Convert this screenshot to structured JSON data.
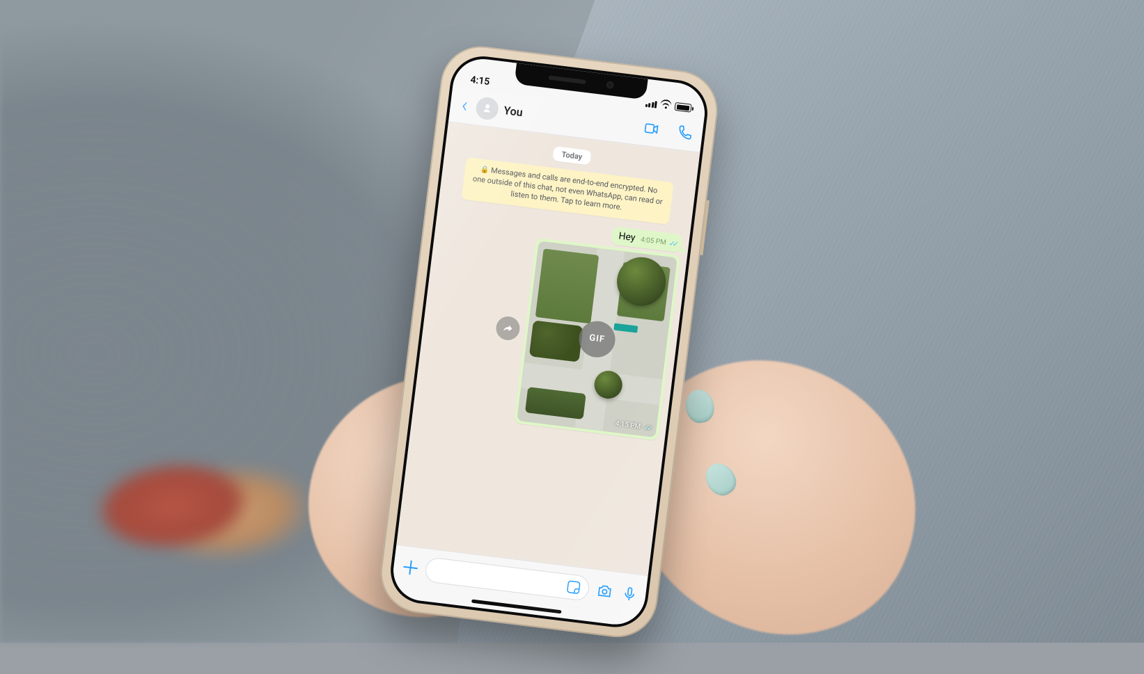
{
  "status": {
    "time": "4:15"
  },
  "header": {
    "contact_name": "You"
  },
  "chat": {
    "date_label": "Today",
    "encryption_notice": "Messages and calls are end-to-end encrypted. No one outside of this chat, not even WhatsApp, can read or listen to them. Tap to learn more.",
    "messages": [
      {
        "text": "Hey",
        "time": "4:05 PM"
      },
      {
        "gif_label": "GIF",
        "time": "4:15 PM"
      }
    ]
  },
  "input": {
    "placeholder": ""
  }
}
